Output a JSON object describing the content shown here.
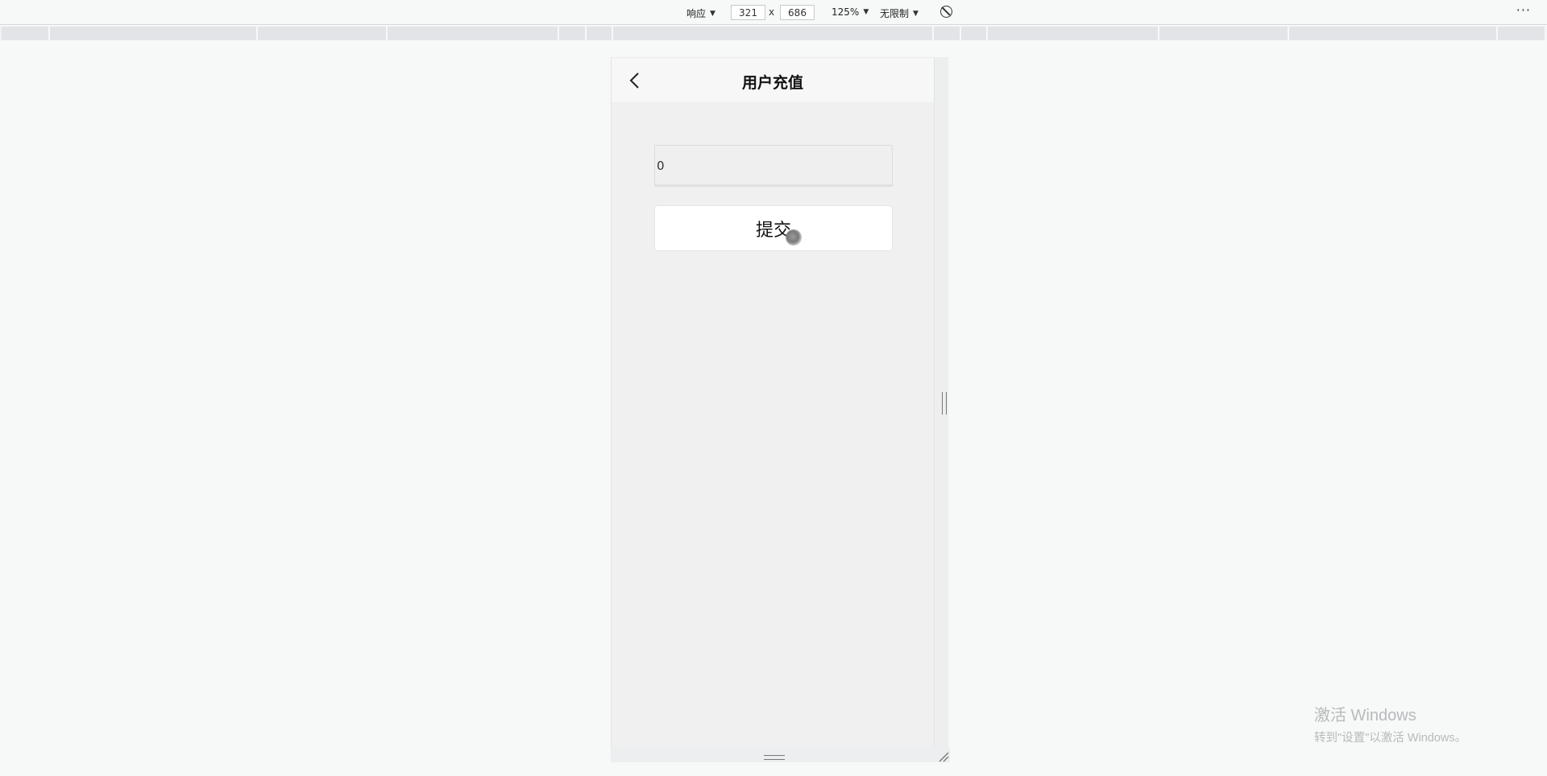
{
  "toolbar": {
    "device_mode": "响应",
    "width_value": "321",
    "height_value": "686",
    "times_sign": "x",
    "zoom": "125%",
    "throttling": "无限制",
    "caret": "▼",
    "more": "⋮"
  },
  "app": {
    "title": "用户充值",
    "amount_value": "0",
    "submit_label": "提交"
  },
  "watermark": {
    "title": "激活 Windows",
    "subtitle": "转到\"设置\"以激活 Windows。"
  }
}
